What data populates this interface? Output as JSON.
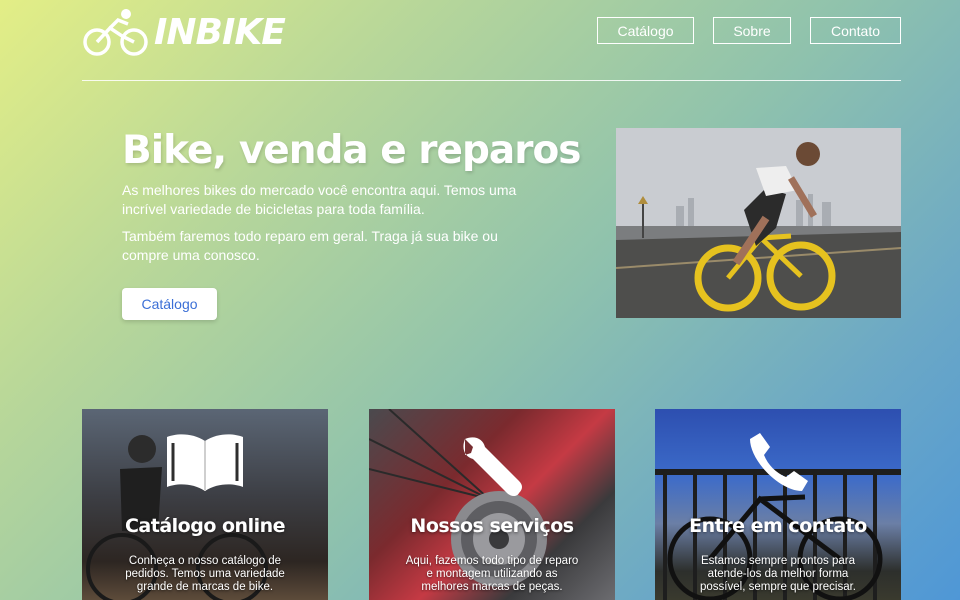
{
  "brand": {
    "name": "INBIKE",
    "logo_icon": "cyclist-icon"
  },
  "nav": {
    "items": [
      {
        "label": "Catálogo"
      },
      {
        "label": "Sobre"
      },
      {
        "label": "Contato"
      }
    ]
  },
  "hero": {
    "title": "Bike, venda e reparos",
    "paragraph1": "As melhores bikes do mercado você encontra aqui. Temos uma incrível variedade de bicicletas para toda família.",
    "paragraph2": "Também faremos todo reparo em geral. Traga já sua bike ou compre uma conosco.",
    "button_label": "Catálogo",
    "button_color": "#3b6fd6"
  },
  "cards": [
    {
      "icon": "book-icon",
      "title": "Catálogo online",
      "text": "Conheça o nosso catálogo de pedidos. Temos uma variedade grande de marcas de bike."
    },
    {
      "icon": "wrench-icon",
      "title": "Nossos serviços",
      "text": "Aqui, fazemos todo tipo de reparo e montagem utilizando as melhores marcas de peças."
    },
    {
      "icon": "phone-icon",
      "title": "Entre em contato",
      "text": "Estamos sempre prontos para atende-los da melhor forma possível, sempre que precisar."
    }
  ]
}
